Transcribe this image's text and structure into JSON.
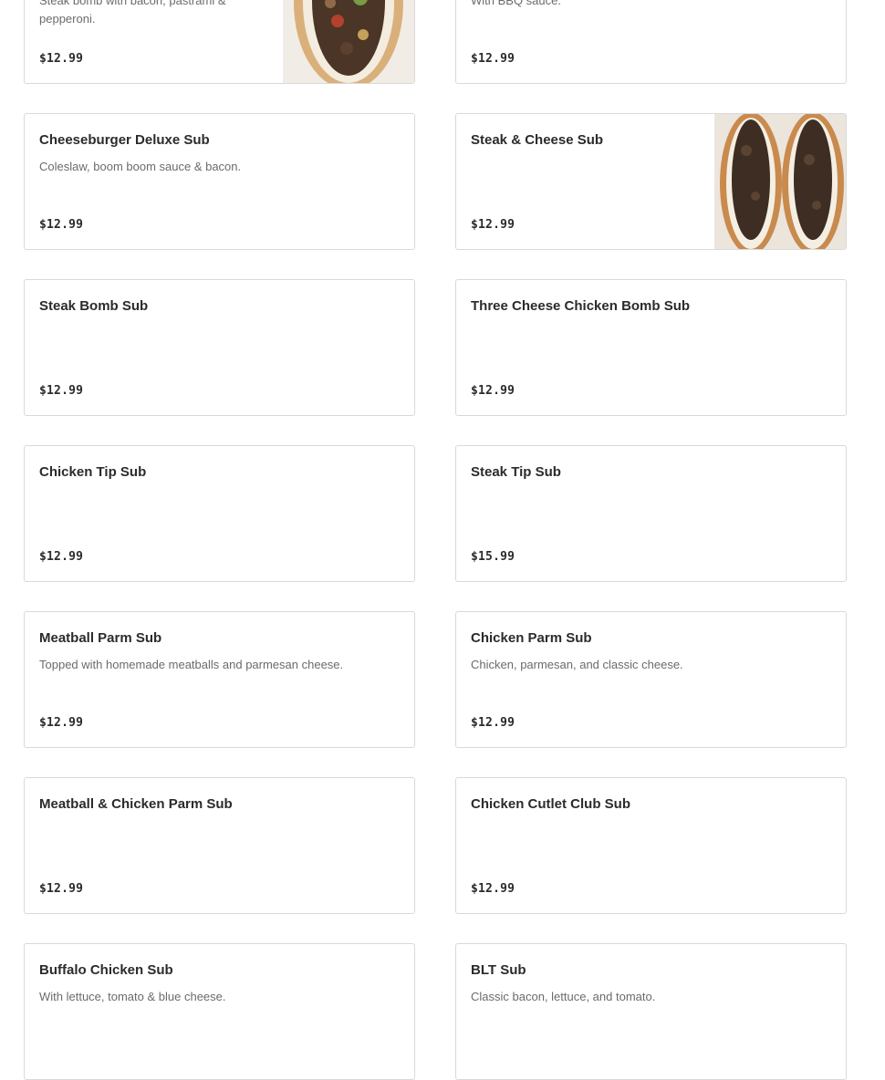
{
  "menu": {
    "items": [
      {
        "name": "",
        "description": "Steak bomb with bacon, pastrami & pepperoni.",
        "price": "$12.99",
        "image": "steak-bomb-sub-photo"
      },
      {
        "name": "",
        "description": "With BBQ sauce.",
        "price": "$12.99",
        "image": ""
      },
      {
        "name": "Cheeseburger Deluxe Sub",
        "description": "Coleslaw, boom boom sauce & bacon.",
        "price": "$12.99",
        "image": ""
      },
      {
        "name": "Steak & Cheese Sub",
        "description": "",
        "price": "$12.99",
        "image": "steak-and-cheese-sub-photo"
      },
      {
        "name": "Steak Bomb Sub",
        "description": "",
        "price": "$12.99",
        "image": ""
      },
      {
        "name": "Three Cheese Chicken Bomb Sub",
        "description": "",
        "price": "$12.99",
        "image": ""
      },
      {
        "name": "Chicken Tip Sub",
        "description": "",
        "price": "$12.99",
        "image": ""
      },
      {
        "name": "Steak Tip Sub",
        "description": "",
        "price": "$15.99",
        "image": ""
      },
      {
        "name": "Meatball Parm Sub",
        "description": "Topped with homemade meatballs and parmesan cheese.",
        "price": "$12.99",
        "image": ""
      },
      {
        "name": "Chicken Parm Sub",
        "description": "Chicken, parmesan, and classic cheese.",
        "price": "$12.99",
        "image": ""
      },
      {
        "name": "Meatball & Chicken Parm Sub",
        "description": "",
        "price": "$12.99",
        "image": ""
      },
      {
        "name": "Chicken Cutlet Club Sub",
        "description": "",
        "price": "$12.99",
        "image": ""
      },
      {
        "name": "Buffalo Chicken Sub",
        "description": "With lettuce, tomato & blue cheese.",
        "price": "",
        "image": ""
      },
      {
        "name": "BLT Sub",
        "description": "Classic bacon, lettuce, and tomato.",
        "price": "",
        "image": ""
      }
    ]
  },
  "colors": {
    "card_border": "#d9d9d9",
    "title_text": "#2b2b2b",
    "description_text": "#6b6b6b"
  }
}
